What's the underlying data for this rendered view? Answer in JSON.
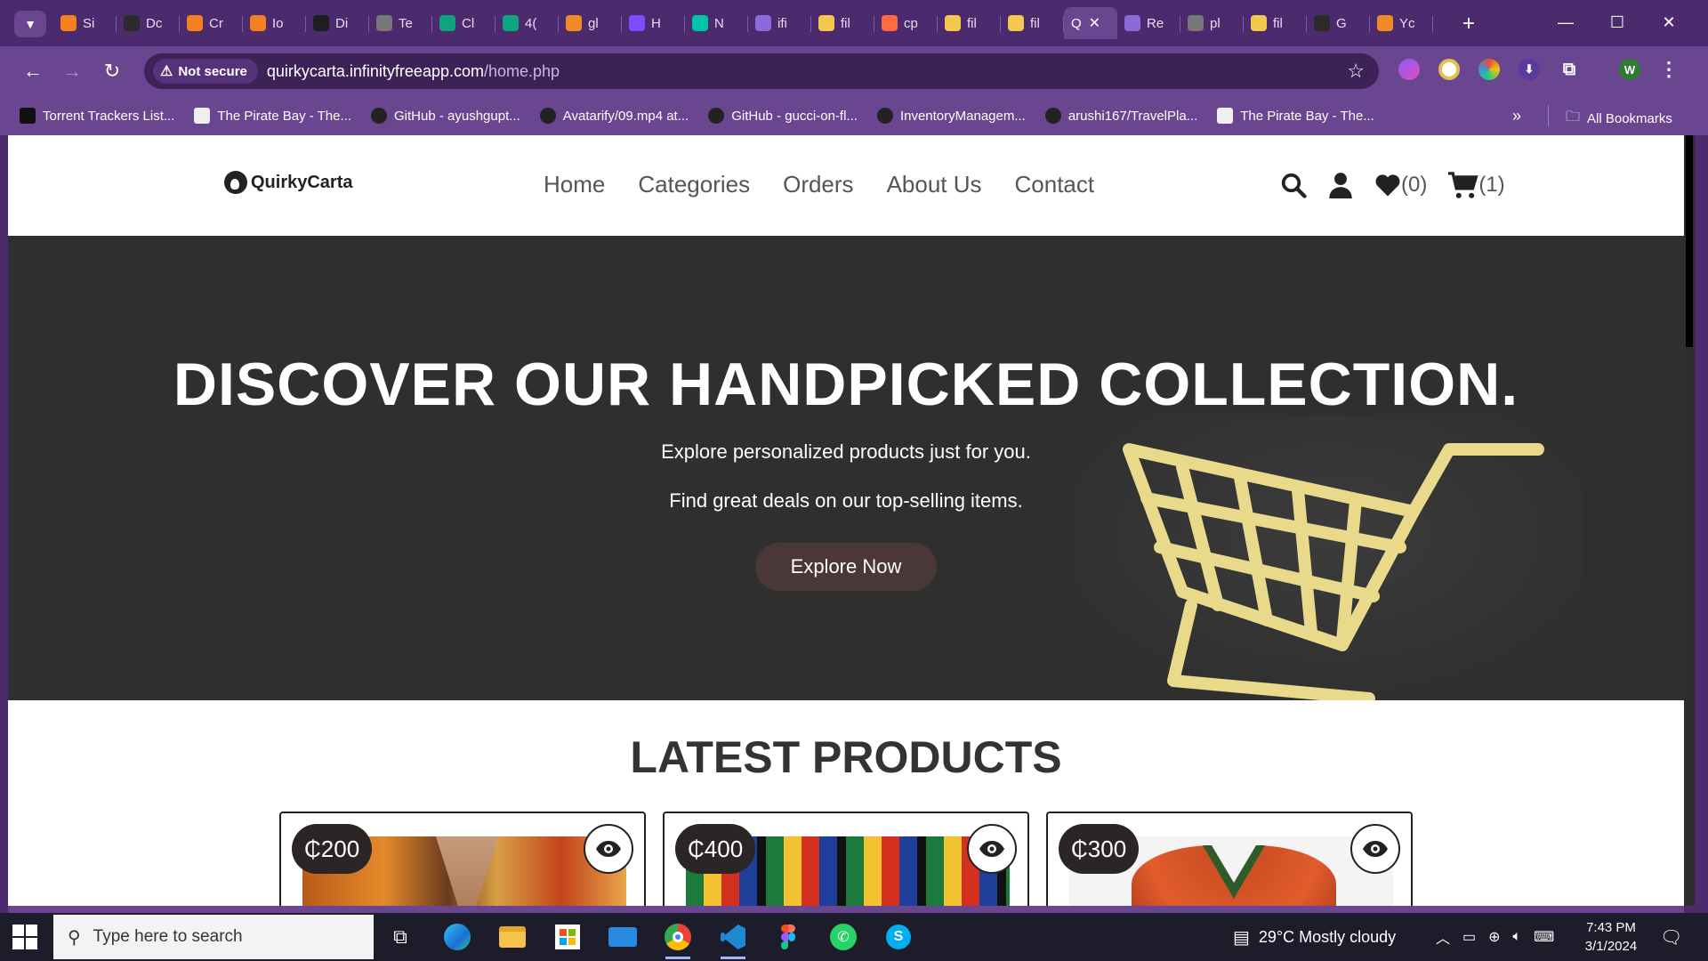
{
  "browser": {
    "tabs": [
      {
        "label": "Si",
        "icon": "codepen-icon",
        "color": "#f4801f"
      },
      {
        "label": "Dc",
        "icon": "github-icon",
        "color": "#2b2b2b"
      },
      {
        "label": "Cr",
        "icon": "codepen-icon",
        "color": "#f4801f"
      },
      {
        "label": "Io",
        "icon": "codepen-icon",
        "color": "#f4801f"
      },
      {
        "label": "Di",
        "icon": "code-icon",
        "color": "#1e1e1e"
      },
      {
        "label": "Te",
        "icon": "globe-icon",
        "color": "#777777"
      },
      {
        "label": "Cl",
        "icon": "chatgpt-icon",
        "color": "#10a37f"
      },
      {
        "label": "4(",
        "icon": "chatgpt-icon",
        "color": "#10a37f"
      },
      {
        "label": "gl",
        "icon": "orange-circle-icon",
        "color": "#f08a24"
      },
      {
        "label": "H",
        "icon": "h-icon",
        "color": "#7c4dff"
      },
      {
        "label": "N",
        "icon": "diamond-icon",
        "color": "#00c4a7"
      },
      {
        "label": "ifi",
        "icon": "infinity-icon",
        "color": "#8c6ad8"
      },
      {
        "label": "fil",
        "icon": "shield-icon",
        "color": "#f2c94c"
      },
      {
        "label": "cp",
        "icon": "link-icon",
        "color": "#ff6b3d"
      },
      {
        "label": "fil",
        "icon": "shield-icon",
        "color": "#f2c94c"
      },
      {
        "label": "fil",
        "icon": "shield-icon",
        "color": "#f2c94c"
      }
    ],
    "active_tab": {
      "label": "Q",
      "close": "✕"
    },
    "tabs_after": [
      {
        "label": "Re",
        "icon": "infinity-icon",
        "color": "#8c6ad8"
      },
      {
        "label": "pl",
        "icon": "globe-icon",
        "color": "#777777"
      },
      {
        "label": "fil",
        "icon": "shield-icon",
        "color": "#f2c94c"
      },
      {
        "label": "G",
        "icon": "github-icon",
        "color": "#2b2b2b"
      },
      {
        "label": "Yc",
        "icon": "orange-circle-icon",
        "color": "#f08a24"
      }
    ],
    "new_tab": "+",
    "not_secure": "Not secure",
    "url_host": "quirkycarta.infinityfreeapp.com",
    "url_path": "/home.php",
    "bookmarks": [
      {
        "label": "Torrent Trackers List...",
        "icon": "tt-icon"
      },
      {
        "label": "The Pirate Bay - The...",
        "icon": "pirate-ship-icon"
      },
      {
        "label": "GitHub - ayushgupt...",
        "icon": "github-icon"
      },
      {
        "label": "Avatarify/09.mp4 at...",
        "icon": "github-icon"
      },
      {
        "label": "GitHub - gucci-on-fl...",
        "icon": "github-icon"
      },
      {
        "label": "InventoryManagem...",
        "icon": "github-icon"
      },
      {
        "label": "arushi167/TravelPla...",
        "icon": "github-icon"
      },
      {
        "label": "The Pirate Bay - The...",
        "icon": "pirate-ship-icon"
      }
    ],
    "bookmarks_more": "»",
    "all_bookmarks": "All Bookmarks",
    "profile_initial": "W"
  },
  "site": {
    "logo_text": "QuirkyCarta",
    "nav": [
      "Home",
      "Categories",
      "Orders",
      "About Us",
      "Contact"
    ],
    "wishlist_count": "(0)",
    "cart_count": "(1)",
    "hero": {
      "title": "DISCOVER OUR HANDPICKED COLLECTION.",
      "line1": "Explore personalized products just for you.",
      "line2": "Find great deals on our top-selling items.",
      "button": "Explore Now"
    },
    "latest_title": "LATEST PRODUCTS",
    "products": [
      {
        "price": "₵200"
      },
      {
        "price": "₵400"
      },
      {
        "price": "₵300"
      }
    ]
  },
  "taskbar": {
    "search_placeholder": "Type here to search",
    "weather": "29°C  Mostly cloudy",
    "time": "7:43 PM",
    "date": "3/1/2024"
  },
  "colors": {
    "chrome_frame": "#4b2a6e",
    "chrome_toolbar": "#6a4590",
    "hero_bg": "#2f2f2f",
    "cart_gold": "#e9d98a",
    "explore_btn": "#4a3838"
  }
}
